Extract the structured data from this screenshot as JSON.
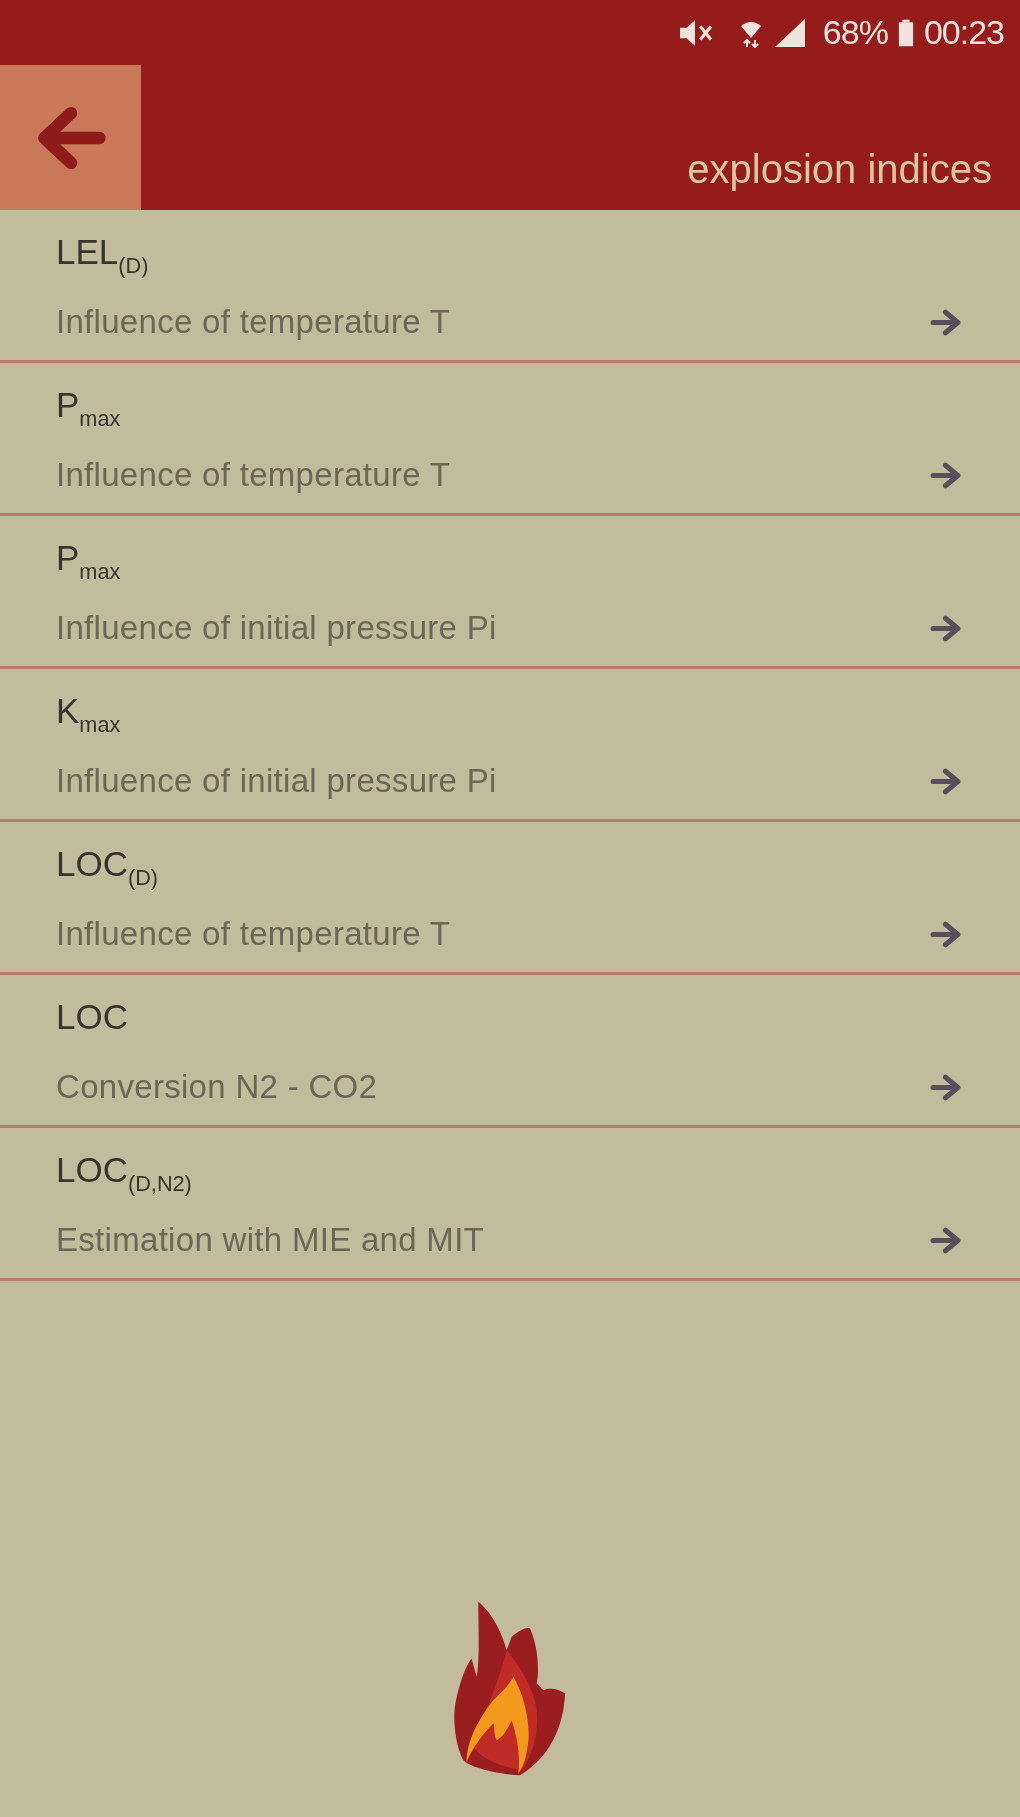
{
  "status_bar": {
    "battery": "68%",
    "time": "00:23"
  },
  "header": {
    "title": "explosion indices"
  },
  "items": [
    {
      "title": "LEL$_{(D)}$",
      "subtitle": "Influence of temperature T"
    },
    {
      "title": "P$_{max}$",
      "subtitle": "Influence of temperature T"
    },
    {
      "title": "P$_{max}$",
      "subtitle": "Influence of initial pressure Pi"
    },
    {
      "title": "K$_{max}$",
      "subtitle": "Influence of initial pressure Pi"
    },
    {
      "title": "LOC$_{(D)}$",
      "subtitle": "Influence of temperature T"
    },
    {
      "title": "LOC",
      "subtitle": "Conversion N2 - CO2"
    },
    {
      "title": "LOC$_{(D,N2)}$",
      "subtitle": "Estimation with MIE and MIT"
    }
  ]
}
